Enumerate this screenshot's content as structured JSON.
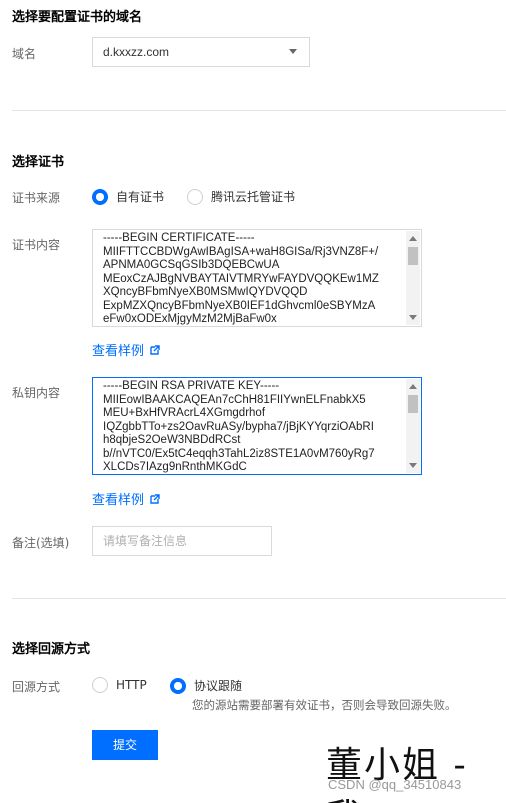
{
  "domain_section": {
    "title": "选择要配置证书的域名",
    "label": "域名",
    "selected_domain": "d.kxxzz.com"
  },
  "cert_section": {
    "title": "选择证书",
    "source_label": "证书来源",
    "source_options": [
      "自有证书",
      "腾讯云托管证书"
    ],
    "source_selected": "自有证书",
    "content_label": "证书内容",
    "certificate_lines": [
      "-----BEGIN CERTIFICATE-----",
      "MIIFTTCCBDWgAwIBAgISA+waH8GISa/Rj3VNZ8F+/",
      "APNMA0GCSqGSIb3DQEBCwUA",
      "MEoxCzAJBgNVBAYTAIVTMRYwFAYDVQQKEw1MZ",
      "XQncyBFbmNyeXB0MSMwIQYDVQQD",
      "ExpMZXQncyBFbmNyeXB0IEF1dGhvcml0eSBYMzA",
      "eFw0xODExMjgyMzM2MjBaFw0x"
    ],
    "view_sample": "查看样例",
    "private_key_label": "私钥内容",
    "private_key_lines": [
      "-----BEGIN RSA PRIVATE KEY-----",
      "MIIEowIBAAKCAQEAn7cChH81FIIYwnELFnabkX5",
      "MEU+BxHfVRAcrL4XGmgdrhof",
      "IQZgbbTTo+zs2OavRuASy/bypha7/jBjKYYqrziOAbRI",
      "h8qbjeS2OeW3NBDdRCst",
      "b//nVTC0/Ex5tC4eqqh3TahL2iz8STE1A0vM760yRg7",
      "XLCDs7IAzg9nRnthMKGdC"
    ],
    "view_sample_2": "查看样例",
    "remark_label": "备注(选填)",
    "remark_placeholder": "请填写备注信息"
  },
  "origin_section": {
    "title": "选择回源方式",
    "label": "回源方式",
    "options": [
      "HTTP",
      "协议跟随"
    ],
    "selected": "协议跟随",
    "hint": "您的源站需要部署有效证书，否则会导致回源失败。"
  },
  "submit_label": "提交",
  "watermark": "董小姐 - 我",
  "credit": "CSDN @qq_34510843",
  "colors": {
    "accent": "#006eff",
    "border": "#d9d9d9"
  }
}
